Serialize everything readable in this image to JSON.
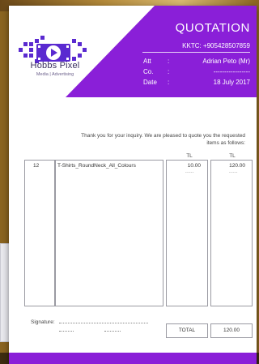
{
  "colors": {
    "accent": "#8a1fd8",
    "logo": "#5a2ad0",
    "text": "#444444"
  },
  "brand": {
    "name": "Hobbs Pixel",
    "tagline": "Media | Advertising",
    "logo_icon": "play-film-icon"
  },
  "header": {
    "title": "QUOTATION",
    "contact": "KKTC: +905428507859",
    "fields": [
      {
        "label": "Att",
        "colon": ":",
        "value": "Adrian Peto (Mr)"
      },
      {
        "label": "Co.",
        "colon": ":",
        "value": "-----------------"
      },
      {
        "label": "Date",
        "colon": ":",
        "value": "18 July 2017"
      }
    ]
  },
  "intro": {
    "line1": "Thank you for your inquiry. We are pleased to quote you the requested",
    "line2": "items as follows:"
  },
  "table": {
    "currency_headers": [
      "TL",
      "TL"
    ],
    "rows": [
      {
        "qty": "12",
        "description": "T-Shirts_RoundNeck_All_Colours",
        "unit_price": "10.00",
        "amount": "120.00",
        "dash": "-----"
      }
    ]
  },
  "signature": {
    "label": "Signature:"
  },
  "total": {
    "label": "TOTAL",
    "value": "120.00"
  }
}
